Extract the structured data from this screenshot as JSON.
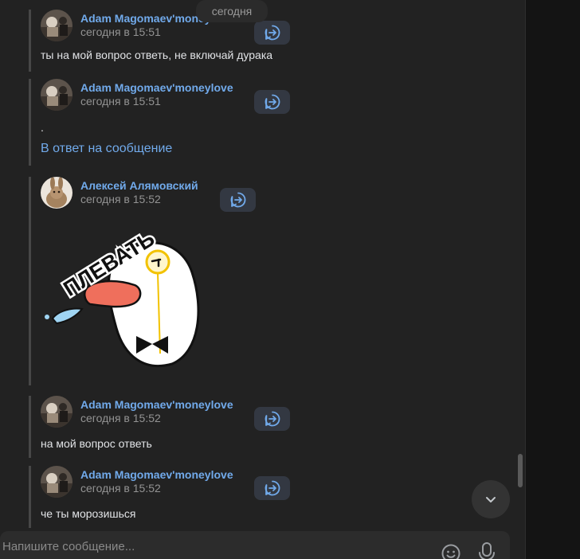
{
  "date_separator": "сегодня",
  "messages": [
    {
      "author": "Adam Magomaev'moneylove",
      "time": "сегодня в 15:51",
      "text": "ты на мой вопрос ответь, не включай дурака"
    },
    {
      "author": "Adam Magomaev'moneylove",
      "time": "сегодня в 15:51",
      "text": ".",
      "reply_link": "В ответ на сообщение"
    },
    {
      "author": "Алексей Алямовский",
      "time": "сегодня в 15:52",
      "sticker_text": "ПЛЕВАТЬ"
    },
    {
      "author": "Adam Magomaev'moneylove",
      "time": "сегодня в 15:52",
      "text": "на мой вопрос ответь"
    },
    {
      "author": "Adam Magomaev'moneylove",
      "time": "сегодня в 15:52",
      "text": "че ты морозишься"
    }
  ],
  "composer": {
    "placeholder": "Напишите сообщение..."
  },
  "icons": {
    "forward": "forward-reply-icon",
    "scroll": "chevron-down-icon",
    "emoji": "smile-icon",
    "mic": "microphone-icon"
  },
  "colors": {
    "accent": "#71aaeb",
    "background": "#222222",
    "text": "#e1e3e6",
    "muted": "#939393"
  }
}
